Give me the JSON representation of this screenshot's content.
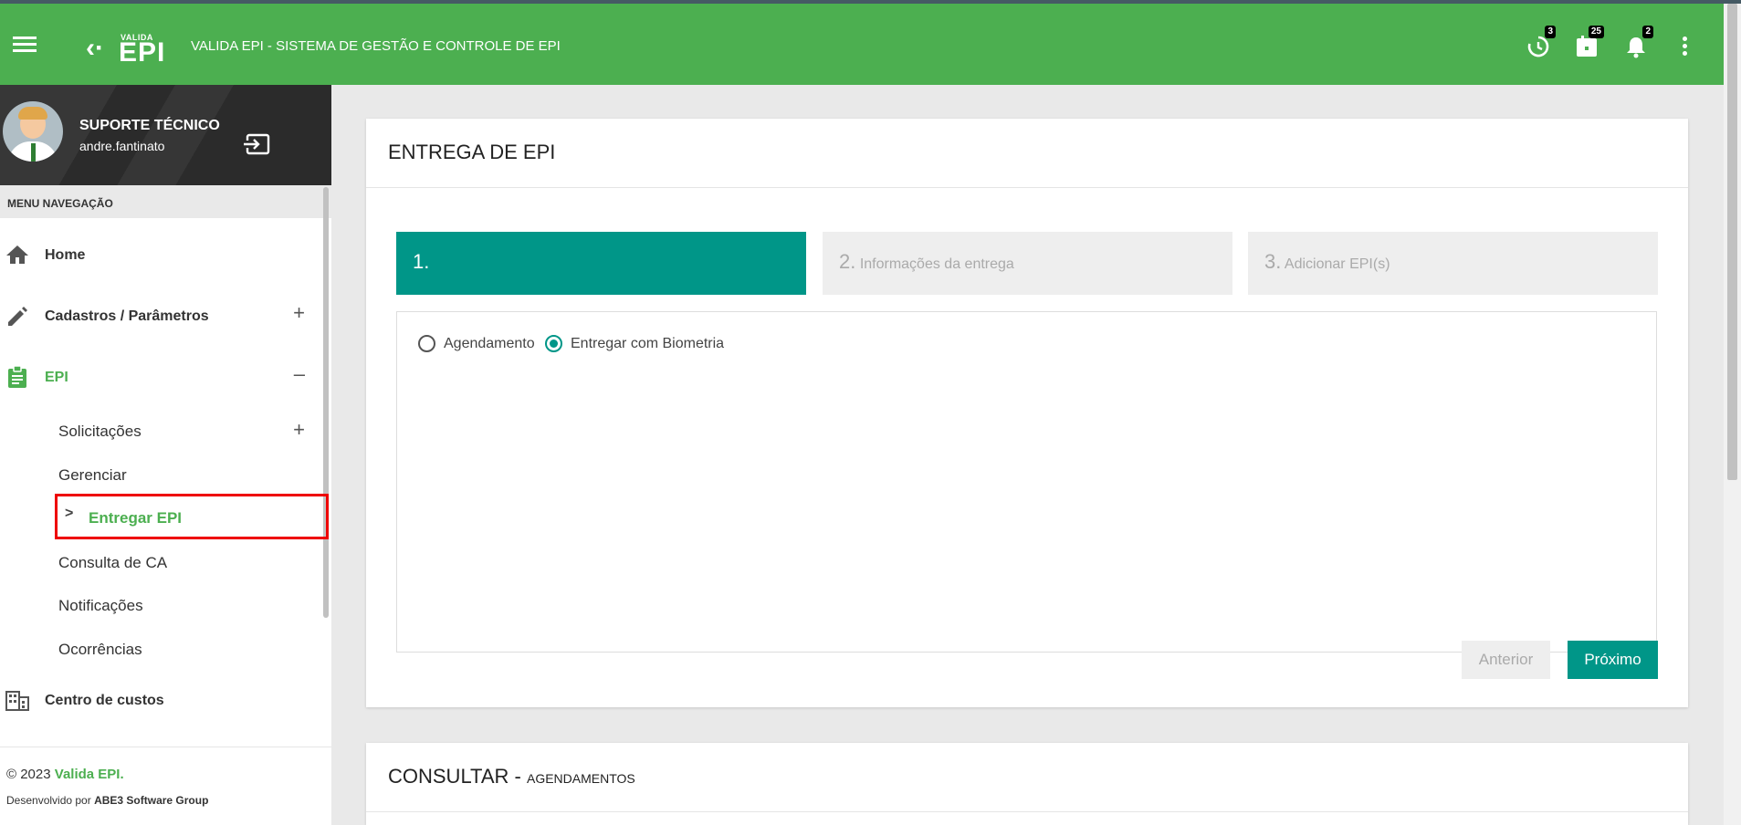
{
  "header": {
    "logo_small": "VALIDA",
    "logo_big": "EPI",
    "title": "VALIDA EPI - SISTEMA DE GESTÃO E CONTROLE DE EPI",
    "badges": {
      "history": "3",
      "calendar": "25",
      "notifications": "2"
    }
  },
  "user": {
    "name": "SUPORTE TÉCNICO",
    "login": "andre.fantinato"
  },
  "menu": {
    "header": "MENU NAVEGAÇÃO",
    "items": [
      {
        "label": "Home"
      },
      {
        "label": "Cadastros / Parâmetros",
        "toggle": "+"
      },
      {
        "label": "EPI",
        "toggle": "–"
      },
      {
        "label": "Centro de custos"
      }
    ],
    "epi_sub": [
      {
        "label": "Solicitações",
        "toggle": "+"
      },
      {
        "label": "Gerenciar"
      },
      {
        "label": "Entregar EPI"
      },
      {
        "label": "Consulta de CA"
      },
      {
        "label": "Notificações"
      },
      {
        "label": "Ocorrências"
      }
    ]
  },
  "footer": {
    "copy_prefix": "© 2023 ",
    "copy_brand": "Valida EPI",
    "copy_suffix": ".",
    "dev_prefix": "Desenvolvido por ",
    "dev_company": "ABE3 Software Group"
  },
  "entrega": {
    "title": "ENTREGA DE EPI",
    "steps": [
      {
        "num": "1.",
        "label": ""
      },
      {
        "num": "2.",
        "label": "Informações da entrega"
      },
      {
        "num": "3.",
        "label": "Adicionar EPI(s)"
      }
    ],
    "options": [
      {
        "label": "Agendamento",
        "selected": false
      },
      {
        "label": "Entregar com Biometria",
        "selected": true
      }
    ],
    "prev_button": "Anterior",
    "next_button": "Próximo"
  },
  "consultar": {
    "title": "CONSULTAR - ",
    "subtitle": "AGENDAMENTOS"
  },
  "colors": {
    "brand_green": "#4caf50",
    "teal": "#009688",
    "highlight": "#ee0000"
  }
}
